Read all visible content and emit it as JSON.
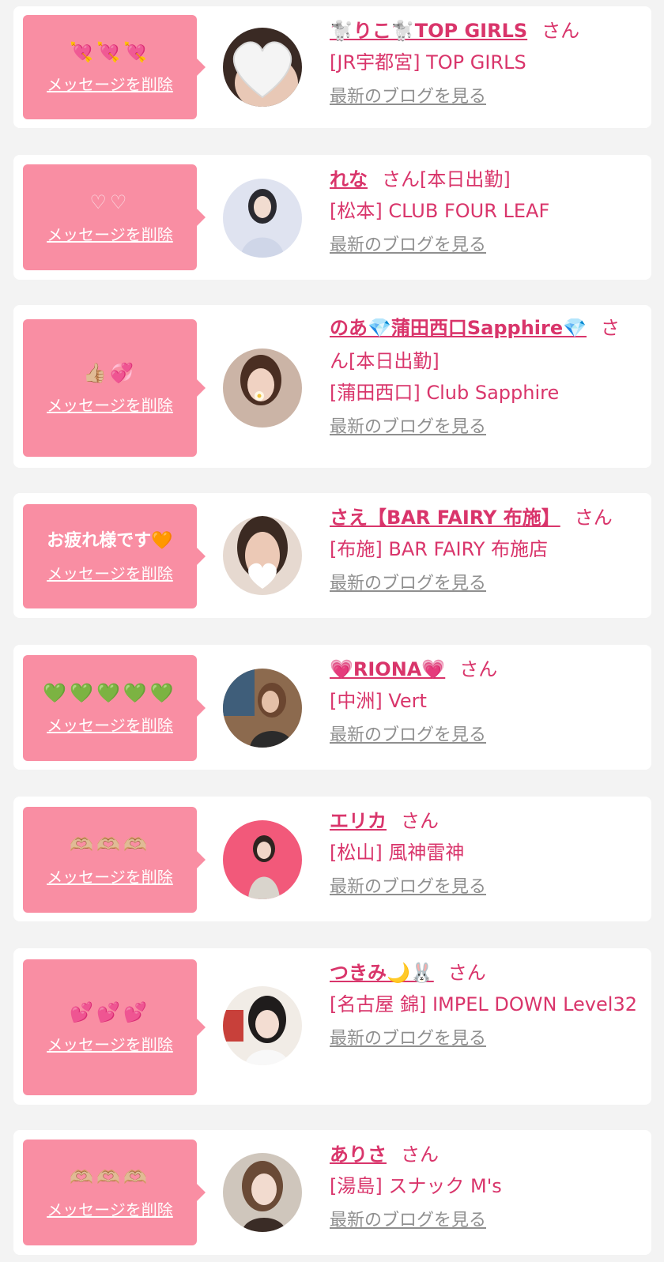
{
  "delete_label": "メッセージを削除",
  "blog_label": "最新のブログを見る",
  "honorific": "さん",
  "colors": {
    "accent": "#d9356b",
    "bubble": "#f98ea3",
    "card": "#ffffff",
    "background": "#f3f3f3",
    "blog_link": "#8f8f8f"
  },
  "items": [
    {
      "message": "💘💘💘",
      "name": "🐩りこ🐩TOP GIRLS",
      "status": "",
      "shop": "[JR宇都宮] TOP GIRLS",
      "avatar_icon": "heart-icon"
    },
    {
      "message": "♡♡",
      "name": "れな",
      "status": "[本日出勤]",
      "shop": "[松本] CLUB FOUR LEAF",
      "avatar_icon": "person-photo"
    },
    {
      "message": "👍🏼💞",
      "name": "のあ💎蒲田西口Sapphire💎",
      "status": "[本日出勤]",
      "shop": "[蒲田西口] Club Sapphire",
      "avatar_icon": "person-photo"
    },
    {
      "message": "お疲れ様です🧡",
      "name": "さえ【BAR FAIRY 布施】",
      "status": "",
      "shop": "[布施] BAR FAIRY 布施店",
      "avatar_icon": "person-photo"
    },
    {
      "message": "💚💚💚💚💚",
      "name": "💗RIONA💗",
      "status": "",
      "shop": "[中洲] Vert",
      "avatar_icon": "person-photo"
    },
    {
      "message": "🫶🏼🫶🏼🫶🏼",
      "name": "エリカ",
      "status": "",
      "shop": "[松山] 風神雷神",
      "avatar_icon": "person-photo"
    },
    {
      "message": "💕💕💕",
      "name": "つきみ🌙🐰",
      "status": "",
      "shop": "[名古屋 錦] IMPEL DOWN Level32",
      "avatar_icon": "person-photo"
    },
    {
      "message": "🫶🏼🫶🏼🫶🏼",
      "name": "ありさ",
      "status": "",
      "shop": "[湯島] スナック M's",
      "avatar_icon": "person-photo"
    }
  ]
}
